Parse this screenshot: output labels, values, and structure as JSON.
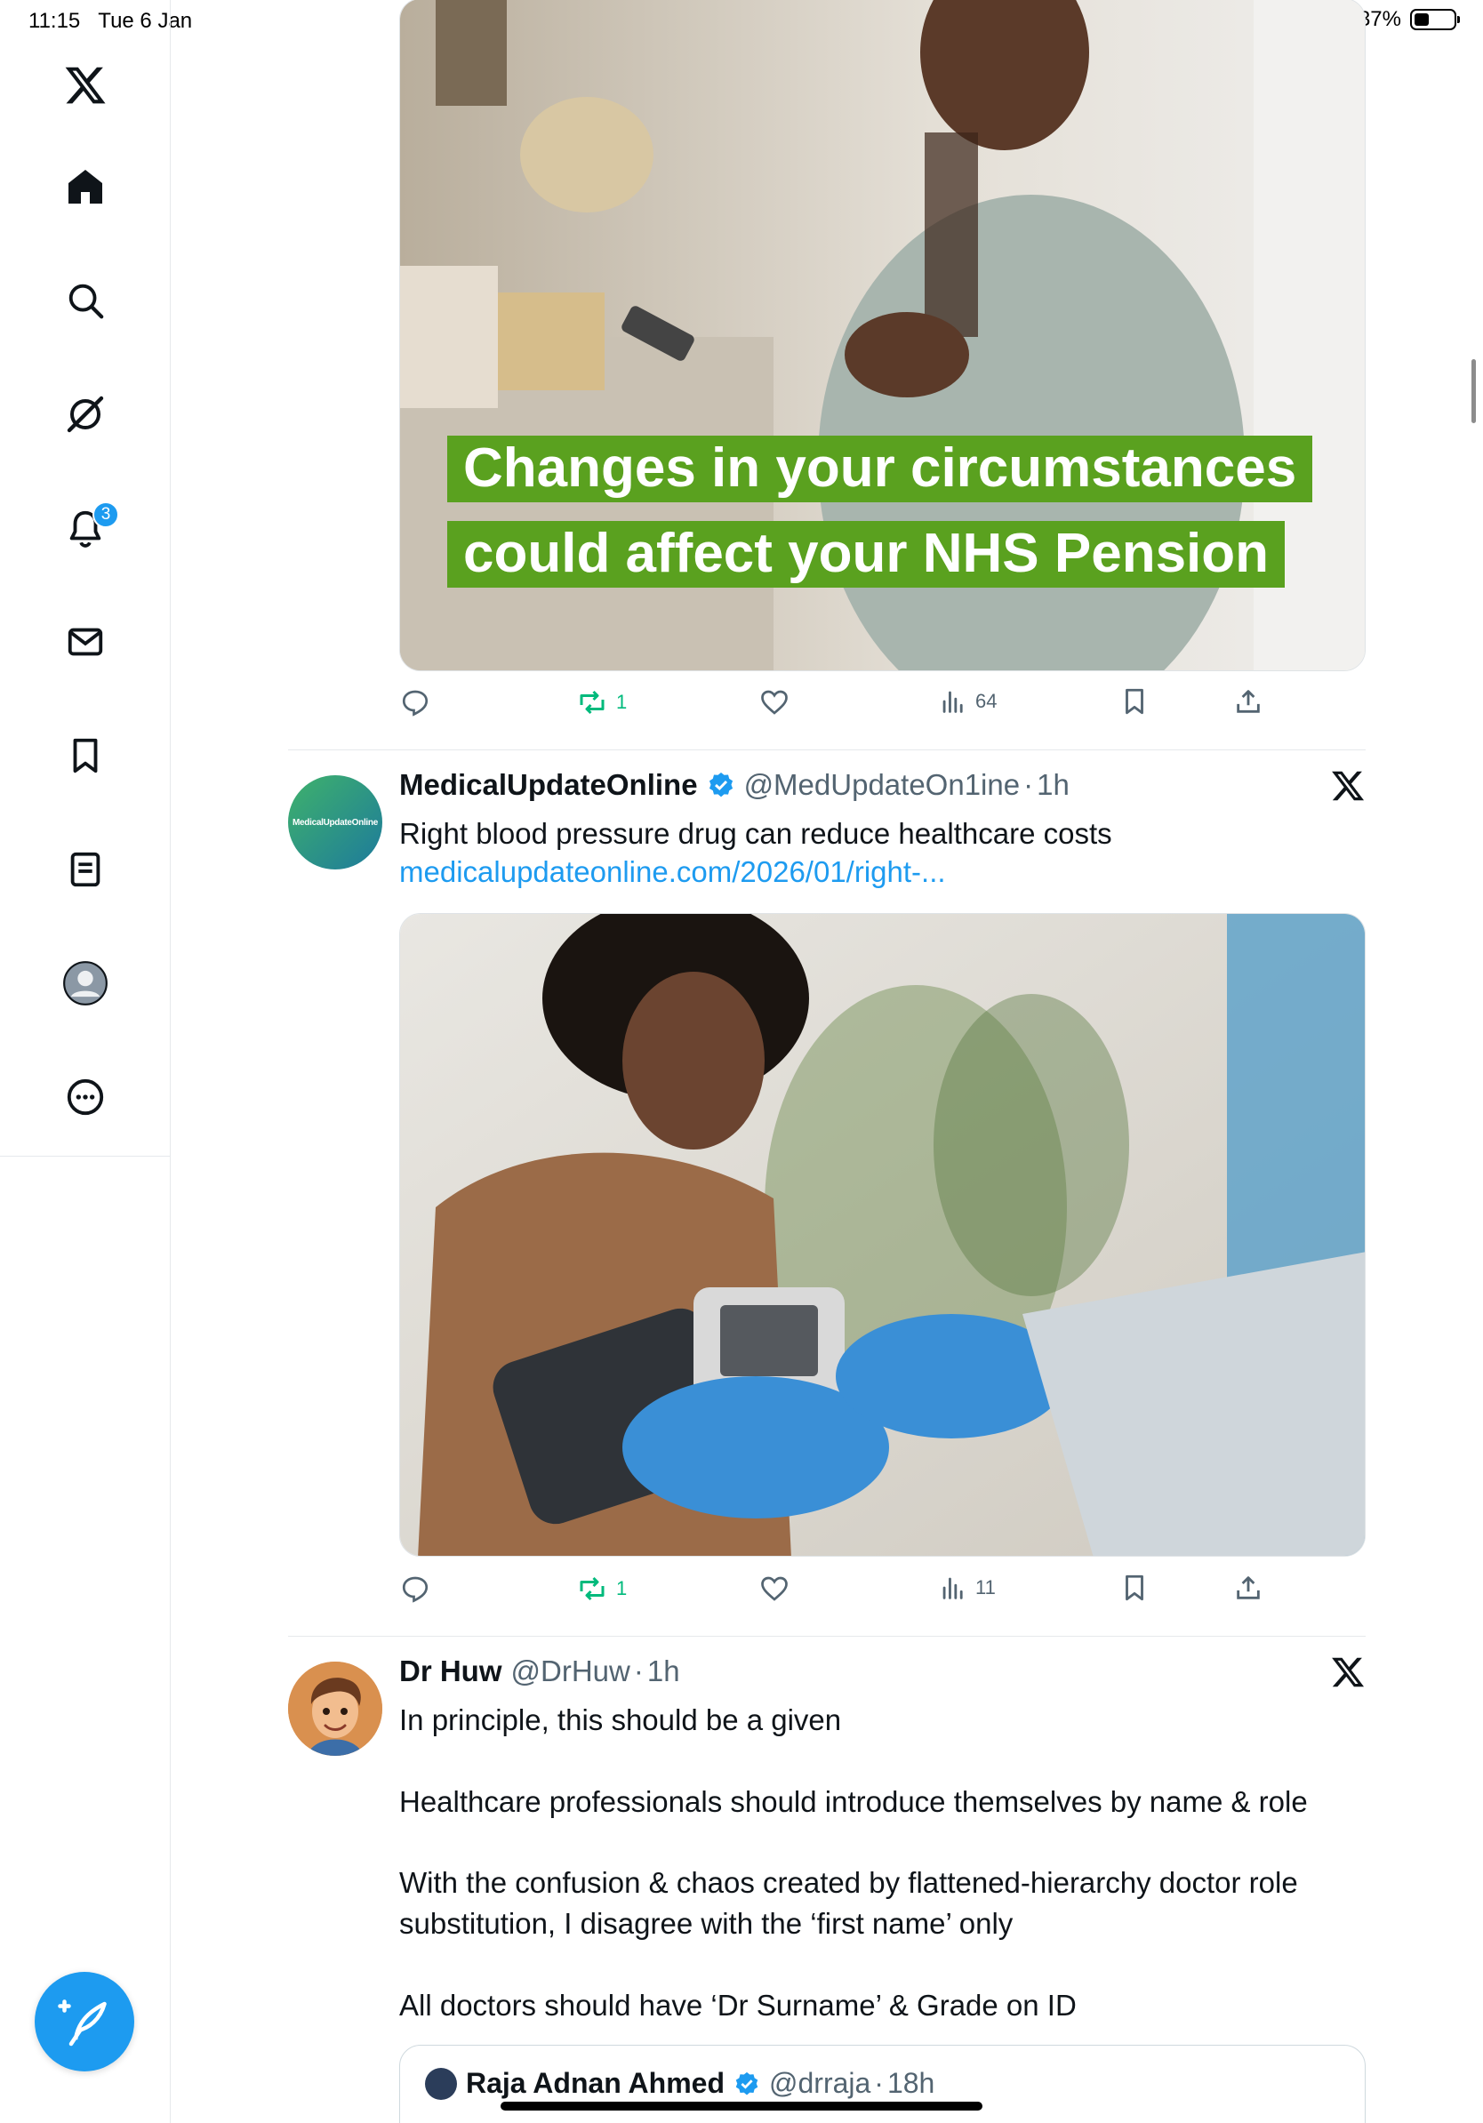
{
  "status": {
    "time": "11:15",
    "date": "Tue 6 Jan",
    "battery": "37%",
    "battery_level": 0.37
  },
  "sidebar": {
    "items": [
      {
        "icon": "x-logo-icon"
      },
      {
        "icon": "home-icon"
      },
      {
        "icon": "search-icon"
      },
      {
        "icon": "grok-icon"
      },
      {
        "icon": "notifications-icon",
        "badge": "3"
      },
      {
        "icon": "messages-icon"
      },
      {
        "icon": "bookmarks-icon"
      },
      {
        "icon": "lists-icon"
      },
      {
        "icon": "profile-icon"
      },
      {
        "icon": "more-icon"
      }
    ],
    "compose_icon": "compose-post-icon"
  },
  "tweets": [
    {
      "media_caption": [
        "Changes in your circumstances",
        "could affect your NHS Pension"
      ],
      "actions": {
        "replies": "",
        "reposts": "1",
        "likes": "",
        "views": "64"
      }
    },
    {
      "name": "MedicalUpdateOnline",
      "verified": true,
      "handle": "@MedUpdateOn1ine",
      "time": "1h",
      "text": "Right blood pressure drug can reduce healthcare costs",
      "link": "medicalupdateonline.com/2026/01/right-...",
      "avatar_text": "MedicalUpdateOnline",
      "actions": {
        "replies": "",
        "reposts": "1",
        "likes": "",
        "views": "11"
      }
    },
    {
      "name": "Dr Huw",
      "verified": false,
      "handle": "@DrHuw",
      "time": "1h",
      "paragraphs": [
        "In principle, this should be a given",
        "Healthcare professionals should introduce themselves by name & role",
        "With the confusion & chaos created by flattened-hierarchy doctor role substitution, I disagree with the ‘first name’ only",
        "All doctors should have ‘Dr Surname’ & Grade on ID"
      ],
      "quote": {
        "name": "Raja Adnan Ahmed",
        "handle": "@drraja",
        "time": "18h"
      }
    }
  ],
  "colors": {
    "accent": "#1d9bf0",
    "repost": "#00ba7c",
    "nhs_green": "#5aa11f"
  }
}
